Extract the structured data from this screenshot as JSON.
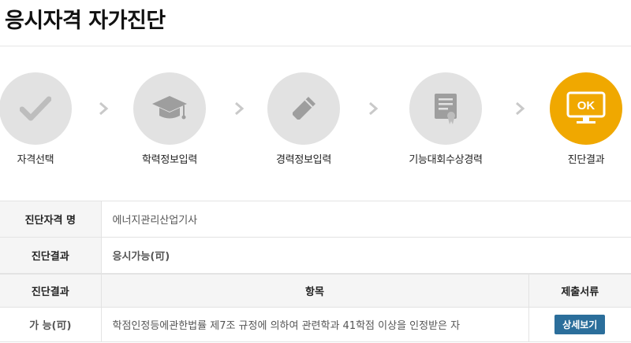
{
  "page": {
    "title": "응시자격 자가진단"
  },
  "steps": [
    {
      "label": "자격선택",
      "icon": "checkmark-icon",
      "active": false
    },
    {
      "label": "학력정보입력",
      "icon": "graduation-cap-icon",
      "active": false
    },
    {
      "label": "경력정보입력",
      "icon": "pencil-icon",
      "active": false
    },
    {
      "label": "기능대회수상경력",
      "icon": "certificate-icon",
      "active": false
    },
    {
      "label": "진단결과",
      "icon": "ok-monitor-icon",
      "active": true,
      "badge": "OK"
    }
  ],
  "colors": {
    "active_step": "#f0a800",
    "inactive_step": "#e2e2e2",
    "accent_text": "#1f6fc0",
    "button": "#2b6e9b"
  },
  "info": {
    "cert_label": "진단자격 명",
    "cert_value": "에너지관리산업기사",
    "result_label": "진단결과",
    "result_value": "응시가능(可)"
  },
  "grid": {
    "headers": [
      "진단결과",
      "항목",
      "제출서류"
    ],
    "rows": [
      {
        "result": "가 능(可)",
        "item": "학점인정등에관한법률 제7조 규정에 의하여 관련학과 41학점 이상을 인정받은 자",
        "doc_button": "상세보기"
      }
    ]
  }
}
